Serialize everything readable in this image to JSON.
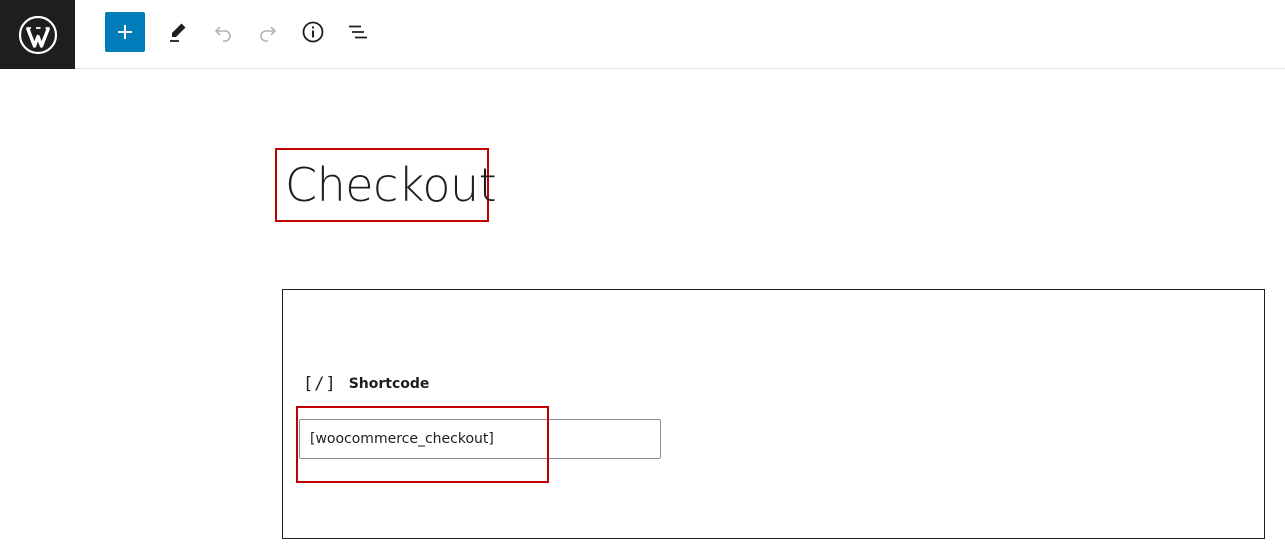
{
  "toolbar": {
    "logo_icon": "wordpress-logo-icon",
    "add_icon": "plus-icon",
    "edit_icon": "pencil-icon",
    "undo_icon": "undo-icon",
    "redo_icon": "redo-icon",
    "info_icon": "info-icon",
    "list_icon": "list-view-icon"
  },
  "colors": {
    "accent": "#007cba",
    "logo_bg": "#1e1e1e",
    "highlight": "#c00000"
  },
  "page": {
    "title": "Checkout"
  },
  "shortcode_block": {
    "icon_glyph": "[/]",
    "label": "Shortcode",
    "value": "[woocommerce_checkout]"
  }
}
